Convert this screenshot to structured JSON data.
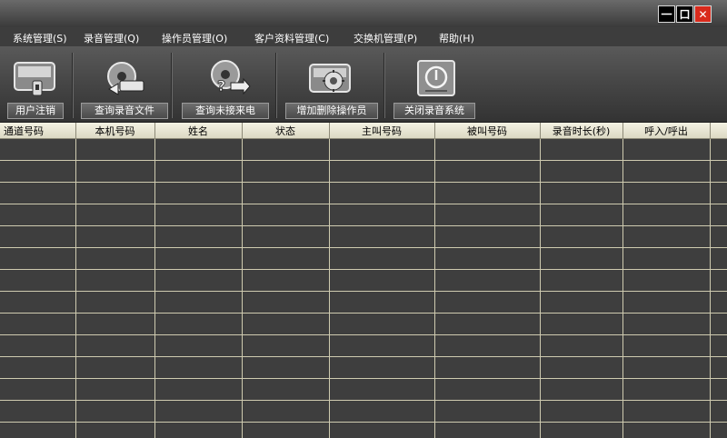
{
  "window": {
    "controls": {
      "minimize": "一",
      "maximize": "口",
      "close": "✕"
    },
    "colors": {
      "close": "#d92a1c"
    }
  },
  "menu": [
    {
      "label": "系统管理(S)",
      "name": "menu-system"
    },
    {
      "label": "录音管理(Q)",
      "name": "menu-recording"
    },
    {
      "label": "操作员管理(O)",
      "name": "menu-operator"
    },
    {
      "label": "客户资料管理(C)",
      "name": "menu-customer"
    },
    {
      "label": "交换机管理(P)",
      "name": "menu-switch"
    },
    {
      "label": "帮助(H)",
      "name": "menu-help"
    }
  ],
  "toolbar": {
    "logout": {
      "label": "用户注销",
      "icon": "logout-icon"
    },
    "query_files": {
      "label": "查询录音文件",
      "icon": "query-recording-icon"
    },
    "query_missed": {
      "label": "查询未接来电",
      "icon": "missed-call-icon"
    },
    "operators": {
      "label": "增加删除操作员",
      "icon": "operator-settings-icon"
    },
    "shutdown": {
      "label": "关闭录音系统",
      "icon": "power-icon"
    }
  },
  "table": {
    "columns": [
      "通道号码",
      "本机号码",
      "姓名",
      "状态",
      "主叫号码",
      "被叫号码",
      "录音时长(秒)",
      "呼入/呼出"
    ],
    "rows": []
  },
  "colors": {
    "background": "#3c3c3c",
    "header_bg": "#e8e5d2",
    "grid_line": "#cfcbb0"
  }
}
